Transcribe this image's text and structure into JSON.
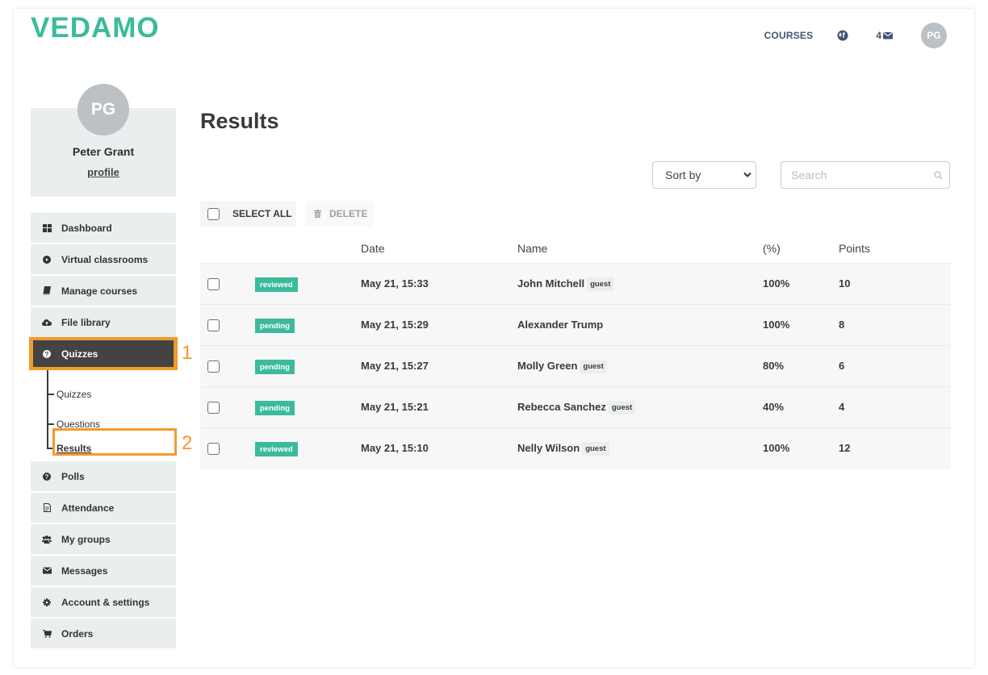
{
  "header": {
    "logo_text": "VEDAMO",
    "brand_color": "#3cbb9c",
    "nav_courses": "COURSES",
    "globe_icon": "globe-icon",
    "messages_count": "4",
    "messages_icon": "envelope-icon",
    "user_initials": "PG"
  },
  "profile": {
    "initials": "PG",
    "name": "Peter Grant",
    "link": "profile"
  },
  "sidebar": {
    "items": [
      {
        "label": "Dashboard",
        "icon": "grid-icon"
      },
      {
        "label": "Virtual classrooms",
        "icon": "play-circle-icon"
      },
      {
        "label": "Manage courses",
        "icon": "book-icon"
      },
      {
        "label": "File library",
        "icon": "cloud-upload-icon"
      },
      {
        "label": "Quizzes",
        "icon": "question-circle-icon",
        "active": true
      },
      {
        "label": "Polls",
        "icon": "question-circle-icon"
      },
      {
        "label": "Attendance",
        "icon": "document-icon"
      },
      {
        "label": "My groups",
        "icon": "users-icon"
      },
      {
        "label": "Messages",
        "icon": "envelope-icon"
      },
      {
        "label": "Account & settings",
        "icon": "gear-icon"
      },
      {
        "label": "Orders",
        "icon": "cart-icon"
      }
    ],
    "quizzes_sub": [
      {
        "label": "Quizzes"
      },
      {
        "label": "Questions"
      },
      {
        "label": "Results",
        "current": true
      }
    ],
    "callouts": [
      "1",
      "2"
    ],
    "callout_color": "#f39a2b"
  },
  "main": {
    "title": "Results",
    "sort_label": "Sort by",
    "search_placeholder": "Search",
    "select_all": "SELECT ALL",
    "delete": "DELETE",
    "columns": [
      "",
      "",
      "Date",
      "Name",
      "(%)",
      "Points"
    ],
    "rows": [
      {
        "status": "reviewed",
        "date": "May 21, 15:33",
        "name": "John Mitchell",
        "guest": "guest",
        "percent": "100%",
        "points": "10"
      },
      {
        "status": "pending",
        "date": "May 21, 15:29",
        "name": "Alexander Trump",
        "guest": null,
        "percent": "100%",
        "points": "8"
      },
      {
        "status": "pending",
        "date": "May 21, 15:27",
        "name": "Molly Green",
        "guest": "guest",
        "percent": "80%",
        "points": "6"
      },
      {
        "status": "pending",
        "date": "May 21, 15:21",
        "name": "Rebecca Sanchez",
        "guest": "guest",
        "percent": "40%",
        "points": "4"
      },
      {
        "status": "reviewed",
        "date": "May 21, 15:10",
        "name": "Nelly Wilson",
        "guest": "guest",
        "percent": "100%",
        "points": "12"
      }
    ],
    "status_color": "#3cbb9c"
  }
}
